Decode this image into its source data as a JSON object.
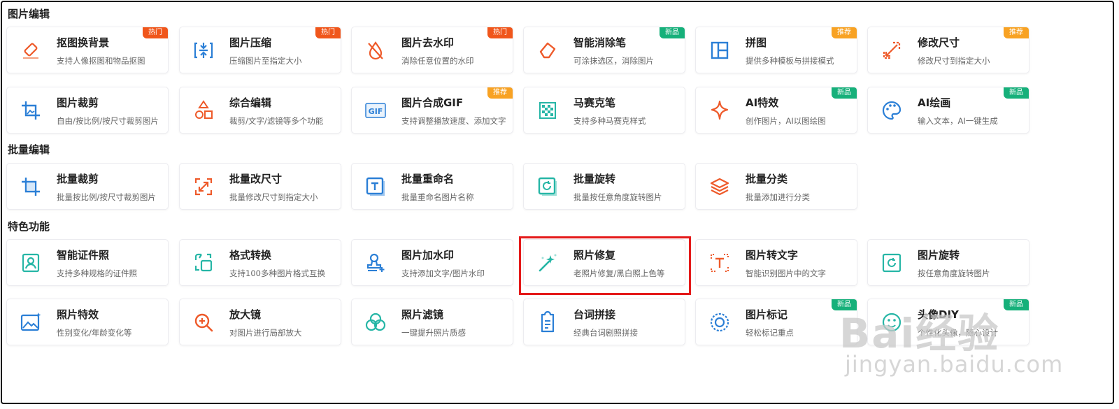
{
  "sections": [
    {
      "title": "图片编辑",
      "cards": [
        {
          "title": "抠图换背景",
          "desc": "支持人像抠图和物品抠图",
          "icon": "eraser-icon",
          "badge": "热门",
          "badge_type": "hot"
        },
        {
          "title": "图片压缩",
          "desc": "压缩图片至指定大小",
          "icon": "compress-icon",
          "badge": "热门",
          "badge_type": "hot"
        },
        {
          "title": "图片去水印",
          "desc": "消除任意位置的水印",
          "icon": "no-watermark-icon",
          "badge": "热门",
          "badge_type": "hot"
        },
        {
          "title": "智能消除笔",
          "desc": "可涂抹选区，消除图片",
          "icon": "eraser-pen-icon",
          "badge": "新品",
          "badge_type": "new"
        },
        {
          "title": "拼图",
          "desc": "提供多种模板与拼接模式",
          "icon": "collage-icon",
          "badge": "推荐",
          "badge_type": "rec"
        },
        {
          "title": "修改尺寸",
          "desc": "修改尺寸到指定大小",
          "icon": "resize-icon",
          "badge": "推荐",
          "badge_type": "rec"
        },
        {
          "title": "图片裁剪",
          "desc": "自由/按比例/按尺寸裁剪图片",
          "icon": "crop-icon",
          "badge": "",
          "badge_type": ""
        },
        {
          "title": "综合编辑",
          "desc": "裁剪/文字/滤镜等多个功能",
          "icon": "shapes-icon",
          "badge": "",
          "badge_type": ""
        },
        {
          "title": "图片合成GIF",
          "desc": "支持调整播放速度、添加文字",
          "icon": "gif-icon",
          "badge": "推荐",
          "badge_type": "rec"
        },
        {
          "title": "马赛克笔",
          "desc": "支持多种马赛克样式",
          "icon": "mosaic-icon",
          "badge": "",
          "badge_type": ""
        },
        {
          "title": "AI特效",
          "desc": "创作图片，AI以图绘图",
          "icon": "sparkle-icon",
          "badge": "新品",
          "badge_type": "new"
        },
        {
          "title": "AI绘画",
          "desc": "输入文本，AI一键生成",
          "icon": "palette-icon",
          "badge": "新品",
          "badge_type": "new"
        }
      ]
    },
    {
      "title": "批量编辑",
      "cards": [
        {
          "title": "批量裁剪",
          "desc": "批量按比例/按尺寸裁剪图片",
          "icon": "batch-crop-icon",
          "badge": "",
          "badge_type": ""
        },
        {
          "title": "批量改尺寸",
          "desc": "批量修改尺寸到指定大小",
          "icon": "batch-resize-icon",
          "badge": "",
          "badge_type": ""
        },
        {
          "title": "批量重命名",
          "desc": "批量重命名图片名称",
          "icon": "rename-icon",
          "badge": "",
          "badge_type": ""
        },
        {
          "title": "批量旋转",
          "desc": "批量按任意角度旋转图片",
          "icon": "rotate-icon",
          "badge": "",
          "badge_type": ""
        },
        {
          "title": "批量分类",
          "desc": "批量添加进行分类",
          "icon": "layers-icon",
          "badge": "",
          "badge_type": ""
        }
      ]
    },
    {
      "title": "特色功能",
      "cards": [
        {
          "title": "智能证件照",
          "desc": "支持多种规格的证件照",
          "icon": "id-photo-icon",
          "badge": "",
          "badge_type": ""
        },
        {
          "title": "格式转换",
          "desc": "支持100多种图片格式互换",
          "icon": "convert-icon",
          "badge": "",
          "badge_type": ""
        },
        {
          "title": "图片加水印",
          "desc": "支持添加文字/图片水印",
          "icon": "stamp-icon",
          "badge": "",
          "badge_type": ""
        },
        {
          "title": "照片修复",
          "desc": "老照片修复/黑白照上色等",
          "icon": "magic-wand-icon",
          "badge": "",
          "badge_type": ""
        },
        {
          "title": "图片转文字",
          "desc": "智能识别图片中的文字",
          "icon": "ocr-icon",
          "badge": "",
          "badge_type": ""
        },
        {
          "title": "图片旋转",
          "desc": "按任意角度旋转图片",
          "icon": "rotate-image-icon",
          "badge": "",
          "badge_type": ""
        },
        {
          "title": "照片特效",
          "desc": "性别变化/年龄变化等",
          "icon": "photo-effect-icon",
          "badge": "",
          "badge_type": ""
        },
        {
          "title": "放大镜",
          "desc": "对图片进行局部放大",
          "icon": "magnifier-icon",
          "badge": "",
          "badge_type": ""
        },
        {
          "title": "照片滤镜",
          "desc": "一键提升照片质感",
          "icon": "filter-icon",
          "badge": "",
          "badge_type": ""
        },
        {
          "title": "台词拼接",
          "desc": "经典台词剧照拼接",
          "icon": "document-icon",
          "badge": "",
          "badge_type": ""
        },
        {
          "title": "图片标记",
          "desc": "轻松标记重点",
          "icon": "mark-icon",
          "badge": "新品",
          "badge_type": "new"
        },
        {
          "title": "头像DIY",
          "desc": "个性化头像，随心设计",
          "icon": "avatar-face-icon",
          "badge": "新品",
          "badge_type": "new"
        }
      ]
    }
  ],
  "watermark": {
    "brand": "Bai经验",
    "url": "jingyan.baidu.com"
  },
  "colors": {
    "hot": "#f0561b",
    "new": "#16b07a",
    "rec": "#f8a223",
    "highlight": "#e41a1a"
  }
}
